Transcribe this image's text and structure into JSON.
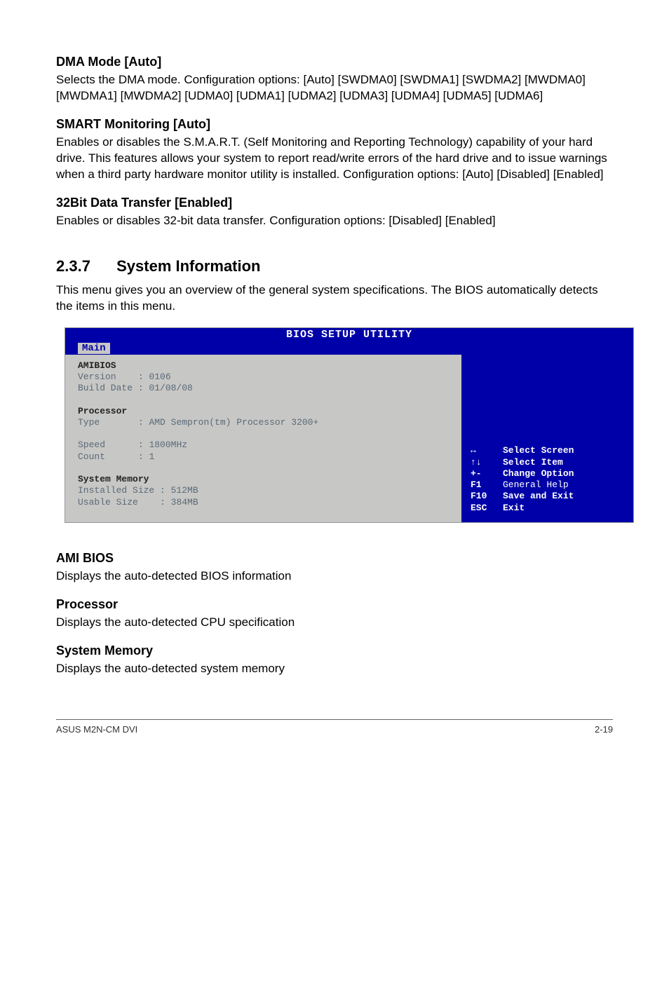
{
  "sections": {
    "dma": {
      "heading": "DMA Mode [Auto]",
      "body": "Selects the DMA mode. Configuration options: [Auto] [SWDMA0] [SWDMA1] [SWDMA2] [MWDMA0] [MWDMA1] [MWDMA2] [UDMA0] [UDMA1] [UDMA2] [UDMA3] [UDMA4] [UDMA5] [UDMA6]"
    },
    "smart": {
      "heading": "SMART Monitoring [Auto]",
      "body": "Enables or disables the S.M.A.R.T. (Self Monitoring and Reporting Technology) capability of your hard drive. This features allows your system to report read/write errors of the hard drive and to issue warnings when a third party hardware monitor utility is installed. Configuration options: [Auto] [Disabled] [Enabled]"
    },
    "bit32": {
      "heading": "32Bit Data Transfer [Enabled]",
      "body": "Enables or disables 32-bit data transfer. Configuration options: [Disabled] [Enabled]"
    },
    "sysinfo": {
      "num": "2.3.7",
      "title": "System Information",
      "body": "This menu gives you an overview of the general system specifications. The BIOS automatically detects the items in this menu."
    },
    "amibios_sec": {
      "heading": "AMI BIOS",
      "body": "Displays the auto-detected BIOS information"
    },
    "processor_sec": {
      "heading": "Processor",
      "body": "Displays the auto-detected CPU specification"
    },
    "sysmem_sec": {
      "heading": "System Memory",
      "body": "Displays the auto-detected system memory"
    }
  },
  "bios": {
    "title": "BIOS SETUP UTILITY",
    "tab": "Main",
    "amibios_label": "AMIBIOS",
    "version_label": "Version",
    "version_value": "0106",
    "builddate_label": "Build Date",
    "builddate_value": "01/08/08",
    "processor_label": "Processor",
    "type_label": "Type",
    "type_value": "AMD Sempron(tm) Processor 3200+",
    "speed_label": "Speed",
    "speed_value": "1800MHz",
    "count_label": "Count",
    "count_value": "1",
    "sysmem_label": "System Memory",
    "installed_label": "Installed Size",
    "installed_value": "512MB",
    "usable_label": "Usable Size",
    "usable_value": "384MB",
    "help": [
      {
        "key": "↔",
        "label": "Select Screen",
        "bold": true
      },
      {
        "key": "↑↓",
        "label": "Select Item",
        "bold": true
      },
      {
        "key": "+-",
        "label": "Change Option",
        "bold": true
      },
      {
        "key": "F1",
        "label": "General Help",
        "bold": false
      },
      {
        "key": "F10",
        "label": "Save and Exit",
        "bold": true
      },
      {
        "key": "ESC",
        "label": "Exit",
        "bold": true
      }
    ]
  },
  "footer": {
    "left": "ASUS M2N-CM DVI",
    "right": "2-19"
  }
}
